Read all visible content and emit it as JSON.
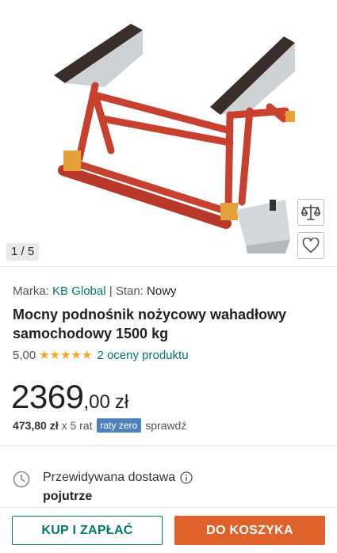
{
  "gallery": {
    "counter": "1 / 5",
    "compare_icon": "compare-scales-icon",
    "favorite_icon": "heart-icon"
  },
  "product": {
    "brand_label": "Marka:",
    "brand": "KB Global",
    "separator": "|",
    "condition_label": "Stan:",
    "condition": "Nowy",
    "title": "Mocny podnośnik nożycowy wahadłowy samochodowy 1500 kg",
    "rating_value": "5,00",
    "stars": "★★★★★",
    "reviews": "2 oceny produktu"
  },
  "price": {
    "integer": "2369",
    "decimal": ",00",
    "currency": "zł"
  },
  "installments": {
    "amount": "473,80 zł",
    "count": "x 5 rat",
    "badge": "raty zero",
    "check": "sprawdź"
  },
  "delivery": {
    "label": "Przewidywana dostawa",
    "value": "pojutrze"
  },
  "actions": {
    "buy_now": "KUP I ZAPŁAĆ",
    "add_to_cart": "DO KOSZYKA"
  },
  "colors": {
    "accent": "#00796b",
    "cart_button": "#e0622b",
    "raty_badge": "#4f81bd",
    "stars": "#f5a623",
    "frame_red": "#c8412f"
  }
}
